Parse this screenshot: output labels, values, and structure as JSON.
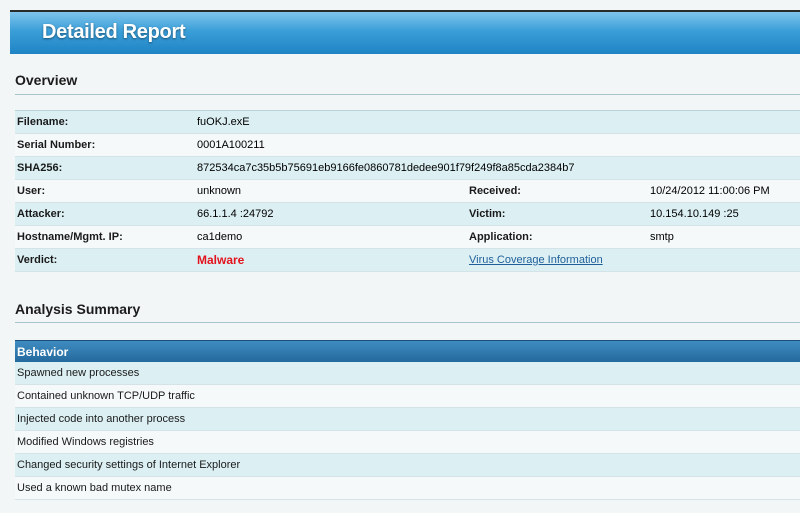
{
  "header": {
    "title": "Detailed Report"
  },
  "overview": {
    "title": "Overview",
    "rows": [
      {
        "label": "Filename:",
        "value": "fuOKJ.exE",
        "label2": "",
        "value2": ""
      },
      {
        "label": "Serial Number:",
        "value": "0001A100211",
        "label2": "",
        "value2": ""
      },
      {
        "label": "SHA256:",
        "value": "872534ca7c35b5b75691eb9166fe0860781dedee901f79f249f8a85cda2384b7",
        "label2": "",
        "value2": ""
      },
      {
        "label": "User:",
        "value": "unknown",
        "label2": "Received:",
        "value2": "10/24/2012 11:00:06 PM"
      },
      {
        "label": "Attacker:",
        "value": "66.1.1.4 :24792",
        "label2": "Victim:",
        "value2": "10.154.10.149 :25"
      },
      {
        "label": "Hostname/Mgmt. IP:",
        "value": "ca1demo",
        "label2": "Application:",
        "value2": "smtp"
      },
      {
        "label": "Verdict:",
        "value": "Malware",
        "label2": "",
        "value2": "Virus Coverage Information"
      }
    ]
  },
  "analysis": {
    "title": "Analysis Summary",
    "behavior_header": "Behavior",
    "behaviors": [
      "Spawned new processes",
      "Contained unknown TCP/UDP traffic",
      "Injected code into another process",
      "Modified Windows registries",
      "Changed security settings of Internet Explorer",
      "Used a known bad mutex name"
    ]
  },
  "colors": {
    "header_blue": "#1f84c4",
    "row_shade": "#dcf0f4",
    "verdict_red": "#e3121c",
    "link_blue": "#1f5f9a",
    "behavior_header": "#24699e"
  }
}
